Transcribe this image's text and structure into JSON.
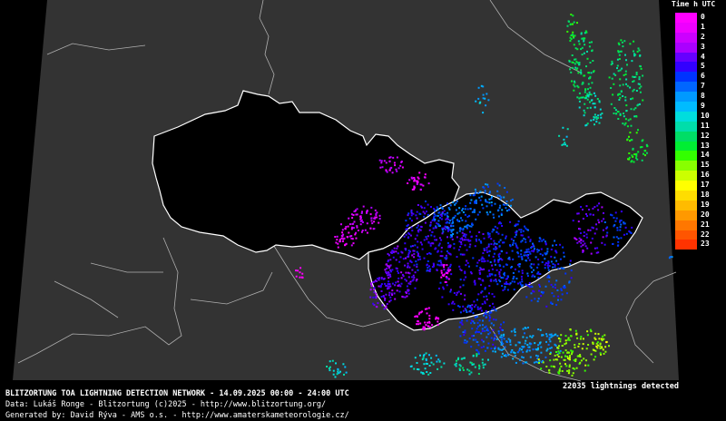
{
  "legend": {
    "title": "Time h UTC",
    "entries": [
      {
        "label": "0",
        "color": "#ff00ff"
      },
      {
        "label": "1",
        "color": "#ee00ff"
      },
      {
        "label": "2",
        "color": "#cc00ff"
      },
      {
        "label": "3",
        "color": "#aa00ff"
      },
      {
        "label": "4",
        "color": "#6600ff"
      },
      {
        "label": "5",
        "color": "#3300ff"
      },
      {
        "label": "6",
        "color": "#0033ff"
      },
      {
        "label": "7",
        "color": "#0066ff"
      },
      {
        "label": "8",
        "color": "#0099ff"
      },
      {
        "label": "9",
        "color": "#00bbff"
      },
      {
        "label": "10",
        "color": "#00dddd"
      },
      {
        "label": "11",
        "color": "#00ddaa"
      },
      {
        "label": "12",
        "color": "#00dd66"
      },
      {
        "label": "13",
        "color": "#00ee33"
      },
      {
        "label": "14",
        "color": "#33ff00"
      },
      {
        "label": "15",
        "color": "#88ff00"
      },
      {
        "label": "16",
        "color": "#ccff00"
      },
      {
        "label": "17",
        "color": "#ffff00"
      },
      {
        "label": "18",
        "color": "#ffdd00"
      },
      {
        "label": "19",
        "color": "#ffbb00"
      },
      {
        "label": "20",
        "color": "#ff9900"
      },
      {
        "label": "21",
        "color": "#ff7700"
      },
      {
        "label": "22",
        "color": "#ff5500"
      },
      {
        "label": "23",
        "color": "#ff3300"
      }
    ]
  },
  "summary": {
    "count_text": "22035 lightnings detected"
  },
  "footer": {
    "line1": "BLITZORTUNG TOA LIGHTNING DETECTION NETWORK - 14.09.2025  00:00 - 24:00 UTC",
    "line2": "Data: Lukáš Ronge - Blitzortung (c)2025  -  http://www.blitzortung.org/",
    "line3": "Generated by: David Rýva - AMS o.s.  -  http://www.amaterskameteorologie.cz/"
  },
  "colors": {
    "background": "#000000",
    "land_outside": "#333333",
    "border": "#ffffff",
    "neighbor_border": "#cccccc"
  }
}
